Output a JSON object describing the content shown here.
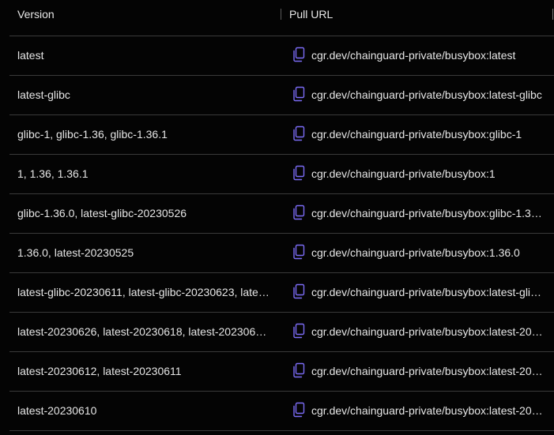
{
  "colors": {
    "background": "#040404",
    "text": "#e6e6e6",
    "divider": "#3a3a3a",
    "copy_icon": "#7b6cf6"
  },
  "header": {
    "version_label": "Version",
    "pull_url_label": "Pull URL"
  },
  "rows": [
    {
      "version": "latest",
      "pull_url": "cgr.dev/chainguard-private/busybox:latest",
      "icon": "copy-icon"
    },
    {
      "version": "latest-glibc",
      "pull_url": "cgr.dev/chainguard-private/busybox:latest-glibc",
      "icon": "copy-icon"
    },
    {
      "version": "glibc-1, glibc-1.36, glibc-1.36.1",
      "pull_url": "cgr.dev/chainguard-private/busybox:glibc-1",
      "icon": "copy-icon"
    },
    {
      "version": "1, 1.36, 1.36.1",
      "pull_url": "cgr.dev/chainguard-private/busybox:1",
      "icon": "copy-icon"
    },
    {
      "version": "glibc-1.36.0, latest-glibc-20230526",
      "pull_url": "cgr.dev/chainguard-private/busybox:glibc-1.3…",
      "icon": "copy-icon"
    },
    {
      "version": "1.36.0, latest-20230525",
      "pull_url": "cgr.dev/chainguard-private/busybox:1.36.0",
      "icon": "copy-icon"
    },
    {
      "version": "latest-glibc-20230611, latest-glibc-20230623, late…",
      "pull_url": "cgr.dev/chainguard-private/busybox:latest-gli…",
      "icon": "copy-icon"
    },
    {
      "version": "latest-20230626, latest-20230618, latest-202306…",
      "pull_url": "cgr.dev/chainguard-private/busybox:latest-20…",
      "icon": "copy-icon"
    },
    {
      "version": "latest-20230612, latest-20230611",
      "pull_url": "cgr.dev/chainguard-private/busybox:latest-20…",
      "icon": "copy-icon"
    },
    {
      "version": "latest-20230610",
      "pull_url": "cgr.dev/chainguard-private/busybox:latest-20…",
      "icon": "copy-icon"
    }
  ]
}
